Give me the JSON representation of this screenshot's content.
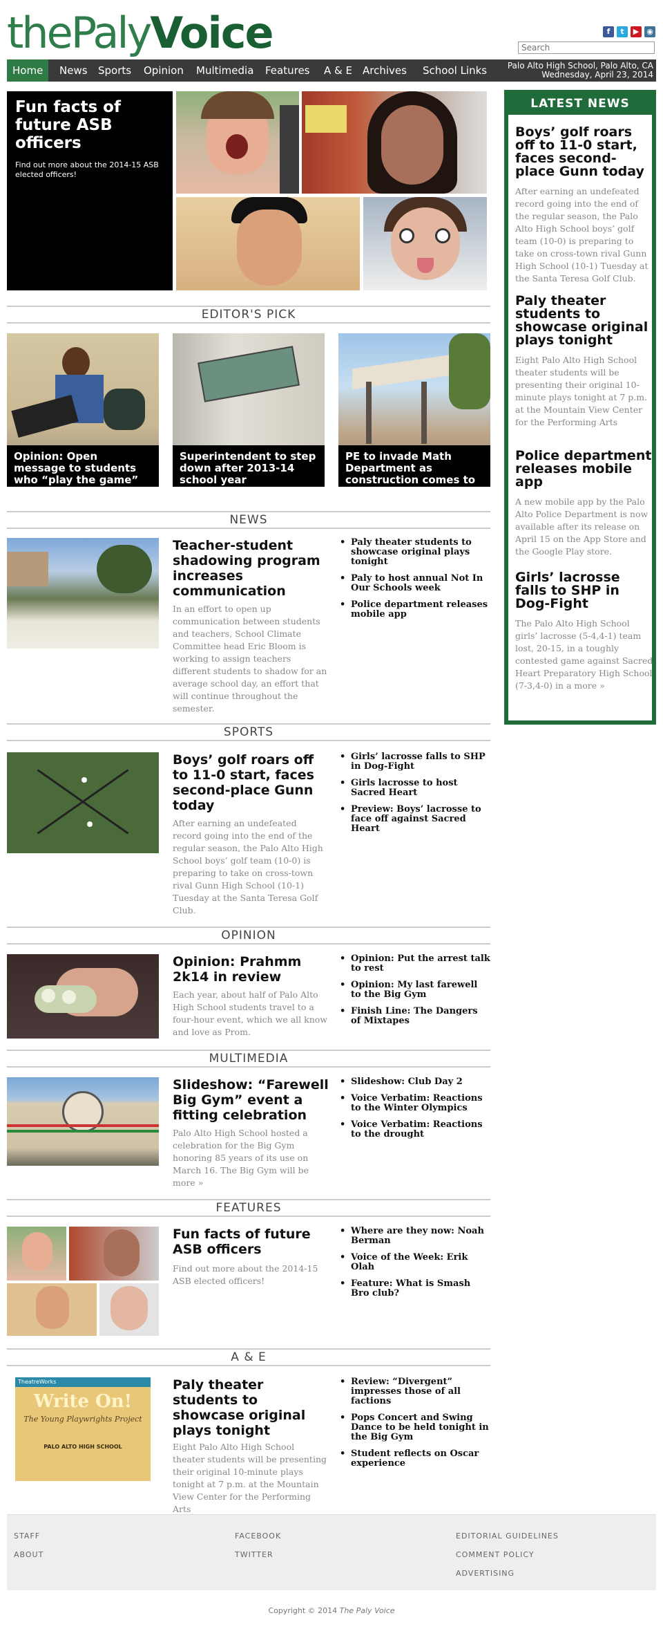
{
  "site": {
    "logo_thin": "thePaly",
    "logo_bold": "Voice"
  },
  "header": {
    "social_icons": [
      {
        "name": "facebook-icon",
        "color": "#3b5998",
        "glyph": "f"
      },
      {
        "name": "twitter-icon",
        "color": "#2aa9e0",
        "glyph": "t"
      },
      {
        "name": "youtube-icon",
        "color": "#cc181e",
        "glyph": "▶"
      },
      {
        "name": "instagram-icon",
        "color": "#3f729b",
        "glyph": "◉"
      }
    ],
    "search_placeholder": "Search"
  },
  "nav": {
    "items": [
      "Home",
      "News",
      "Sports",
      "Opinion",
      "Multimedia",
      "Features",
      "A & E",
      "Archives",
      "School Links"
    ],
    "location": "Palo Alto High School, Palo Alto, CA",
    "date": "Wednesday, April 23, 2014"
  },
  "hero": {
    "title": "Fun facts of future ASB officers",
    "subtitle": "Find out more about the 2014-15 ASB elected officers!"
  },
  "editors_pick": {
    "heading": "EDITOR'S PICK",
    "items": [
      {
        "caption": "Opinion: Open message to students who “play the game”"
      },
      {
        "caption": "Superintendent to step down after 2013-14 school year"
      },
      {
        "caption": "PE to invade Math Department as construction comes to a close"
      }
    ]
  },
  "sections": {
    "news": {
      "heading": "NEWS",
      "headline": "Teacher-student shadowing program increases communication",
      "excerpt": "In an effort to open up communication between students and teachers, School Climate Committee head Eric Bloom is working to assign teachers different students to shadow for an average school day, an effort that will continue throughout the semester.",
      "links": [
        "Paly theater students to showcase original plays tonight",
        "Paly to host annual Not In Our Schools week",
        "Police department releases mobile app"
      ]
    },
    "sports": {
      "heading": "SPORTS",
      "headline": "Boys’ golf roars off to 11-0 start, faces second-place Gunn today",
      "excerpt": "After earning an undefeated record going into the end of the regular season, the Palo Alto High School boys’ golf team (10-0) is preparing to take on cross-town rival Gunn High School (10-1) Tuesday at the Santa Teresa Golf Club.",
      "links": [
        "Girls’ lacrosse falls to SHP in Dog-Fight",
        "Girls lacrosse to host Sacred Heart",
        "Preview: Boys’ lacrosse to face off against Sacred Heart"
      ]
    },
    "opinion": {
      "heading": "OPINION",
      "headline": "Opinion: Prahmm 2k14 in review",
      "excerpt": "Each year, about half of Palo Alto High School students travel to a four-hour event, which we all know and love as Prom.",
      "links": [
        "Opinion: Put the arrest talk to rest",
        "Opinion: My last farewell to the Big Gym",
        "Finish Line: The Dangers of Mixtapes"
      ]
    },
    "multimedia": {
      "heading": "MULTIMEDIA",
      "headline": "Slideshow: “Farewell Big Gym” event a fitting celebration",
      "excerpt": "Palo Alto High School hosted a celebration for the Big Gym honoring 85 years of its use on March 16. The Big Gym will be more »",
      "links": [
        "Slideshow: Club Day 2",
        "Voice Verbatim: Reactions to the Winter Olympics",
        "Voice Verbatim: Reactions to the drought"
      ]
    },
    "features": {
      "heading": "FEATURES",
      "headline": "Fun facts of future ASB officers",
      "excerpt": "Find out more about the 2014-15 ASB elected officers!",
      "links": [
        "Where are they now: Noah Berman",
        "Voice of the Week: Erik Olah",
        "Feature: What is Smash Bro club?"
      ]
    },
    "ae": {
      "heading": "A & E",
      "headline": "Paly theater students to showcase original plays tonight",
      "excerpt": "Eight Palo Alto High School theater students will be presenting their original 10-minute plays tonight at 7 p.m. at the Mountain View Center for the Performing Arts",
      "links": [
        "Review: “Divergent” impresses those of all factions",
        "Pops Concert and Swing Dance to be held tonight in the Big Gym",
        "Student reflects on Oscar experience"
      ],
      "poster": {
        "brand": "TheatreWorks",
        "title": "Write On!",
        "subtitle": "The Young Playwrights Project",
        "school": "PALO ALTO HIGH SCHOOL"
      }
    }
  },
  "latest_news": {
    "heading": "LATEST NEWS",
    "items": [
      {
        "headline": "Boys’ golf roars off to 11-0 start, faces second-place Gunn today",
        "excerpt": "After earning an undefeated record going into the end of the regular season, the Palo Alto High School boys’ golf team (10-0) is preparing to take on cross-town rival Gunn High School (10-1) Tuesday at the Santa Teresa Golf Club."
      },
      {
        "headline": "Paly theater students to showcase original plays tonight",
        "excerpt": "Eight Palo Alto High School theater students will be presenting their original 10-minute plays tonight at 7 p.m. at the Mountain View Center for the Performing Arts"
      },
      {
        "headline": "Police department releases mobile app",
        "excerpt": "A new mobile app by the Palo Alto Police Department is now available after its release on April 15 on the App Store and the Google Play store."
      },
      {
        "headline": "Girls’ lacrosse falls to SHP in Dog-Fight",
        "excerpt": "The Palo Alto High School girls’ lacrosse (5-4,4-1) team lost, 20-15, in a toughly contested game against Sacred Heart Preparatory High School (7-3,4-0) in a more »"
      }
    ]
  },
  "footer": {
    "col1": [
      "STAFF",
      "ABOUT"
    ],
    "col2": [
      "FACEBOOK",
      "TWITTER"
    ],
    "col3": [
      "EDITORIAL GUIDELINES",
      "COMMENT POLICY",
      "ADVERTISING"
    ],
    "copyright_prefix": "Copyright © 2014 ",
    "copyright_name": "The Paly Voice"
  }
}
